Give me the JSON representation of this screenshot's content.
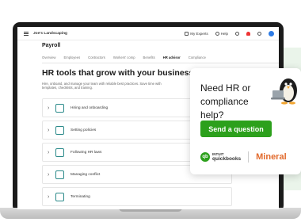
{
  "app": {
    "company_name": "Joe's Landscaping",
    "page_title": "Payroll"
  },
  "topbar": {
    "my_experts": "My Experts",
    "help": "Help"
  },
  "tabs": [
    {
      "label": "Overview",
      "active": false
    },
    {
      "label": "Employees",
      "active": false
    },
    {
      "label": "Contractors",
      "active": false
    },
    {
      "label": "Workers' comp",
      "active": false
    },
    {
      "label": "Benefits",
      "active": false
    },
    {
      "label": "HR advisor",
      "active": true
    },
    {
      "label": "Compliance",
      "active": false
    }
  ],
  "hero": {
    "title": "HR tools that grow with your business",
    "subtitle": "Hire, onboard, and manage your team with reliable best practices. Save time with templates, checklists, and training."
  },
  "hr_topics": [
    {
      "label": "Hiring and onboarding",
      "icon": "person-icon"
    },
    {
      "label": "Setting policies",
      "icon": "document-icon"
    },
    {
      "label": "Following HR laws",
      "icon": "shield-icon"
    },
    {
      "label": "Managing conflict",
      "icon": "people-icon"
    },
    {
      "label": "Terminating",
      "icon": "people-icon"
    }
  ],
  "promo_card": {
    "title": "Need HR or compliance help?",
    "cta_label": "Send a question",
    "brand_qb_intuit": "INTUIT",
    "brand_qb_name": "quickbooks",
    "brand_partner": "Mineral"
  },
  "colors": {
    "accent_green": "#2ca01c",
    "mineral_orange": "#e26a2c"
  }
}
